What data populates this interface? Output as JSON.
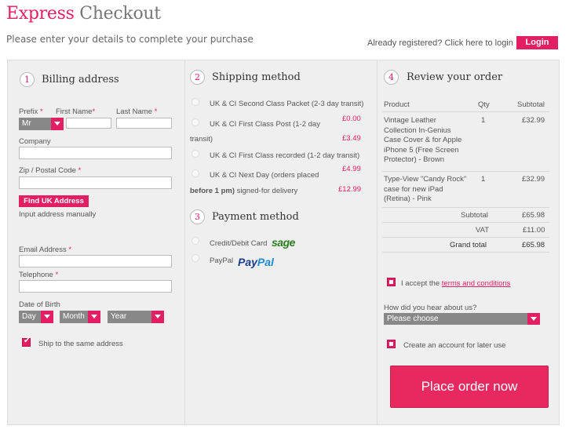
{
  "header": {
    "title_part1": "Express",
    "title_part2": "Checkout",
    "subtitle": "Please enter your details to complete your purchase",
    "already_registered": "Already registered? Click here to login",
    "login_label": "Login"
  },
  "billing": {
    "step": "1",
    "heading": "Billing address",
    "prefix_label": "Prefix",
    "prefix_value": "Mr",
    "first_name_label": "First Name",
    "last_name_label": "Last Name",
    "company_label": "Company",
    "zip_label": "Zip / Postal Code",
    "find_address_label": "Find UK Address",
    "manual_label": "Input address manually",
    "email_label": "Email Address",
    "telephone_label": "Telephone",
    "dob_label": "Date of Birth",
    "dob_day": "Day",
    "dob_month": "Month",
    "dob_year": "Year",
    "ship_same_label": "Ship to the same address",
    "required_mark": "*"
  },
  "shipping": {
    "step": "2",
    "heading": "Shipping method",
    "options": [
      {
        "label": "UK & CI Second Class Packet (2-3 day transit)",
        "price": "£0.00"
      },
      {
        "label_line1": "UK & CI First Class Post (1-2 day",
        "label_line2": "transit)",
        "price": "£3.49"
      },
      {
        "label": "UK & CI First Class recorded (1-2 day transit)",
        "price": "£4.99"
      },
      {
        "label_line1": "UK & CI Next Day (orders placed",
        "label_line2_bold": "before 1 pm)",
        "label_line2_rest": " signed-for delivery",
        "price": "£12.99"
      }
    ]
  },
  "payment": {
    "step": "3",
    "heading": "Payment method",
    "options": [
      {
        "label": "Credit/Debit Card",
        "logo": "sage"
      },
      {
        "label": "PayPal",
        "logo_part1": "Pay",
        "logo_part2": "Pal"
      }
    ]
  },
  "review": {
    "step": "4",
    "heading": "Review your order",
    "columns": [
      "Product",
      "Qty",
      "Subtotal"
    ],
    "items": [
      {
        "line1": "Vintage Leather",
        "line2": "Collection In-Genius",
        "line3": "Case Cover & for Apple",
        "line4": "iPhone 5 (Free Screen",
        "line5": "Protector) - Brown",
        "qty": "1",
        "subtotal": "£32.99"
      },
      {
        "line1": "Type-View \"Candy Rock\"",
        "line2": "case for new iPad",
        "line3": "(Retina) - Pink",
        "qty": "1",
        "subtotal": "£32.99"
      }
    ],
    "subtotal_label": "Subtotal",
    "subtotal_value": "£65.98",
    "vat_label": "VAT",
    "vat_value": "£11.00",
    "grand_label": "Grand total",
    "grand_value": "£65.98",
    "terms_prefix": "I accept the ",
    "terms_link": "terms and conditions",
    "hear_label": "How did you hear about us?",
    "hear_value": "Please choose",
    "create_account_label": "Create an account for later use",
    "place_order_label": "Place order now"
  },
  "colors": {
    "accent": "#e31e62",
    "panel": "#efefef"
  }
}
